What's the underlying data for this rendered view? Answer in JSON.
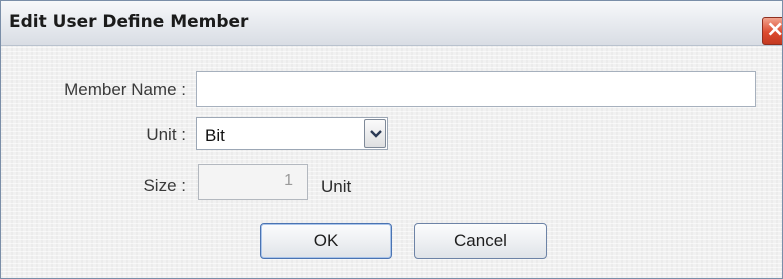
{
  "window": {
    "title": "Edit User Define Member",
    "close_symbol": "×"
  },
  "form": {
    "member_name_label": "Member Name :",
    "member_name_value": "",
    "unit_label": "Unit :",
    "unit_selected": "Bit",
    "size_label": "Size :",
    "size_value": "1",
    "size_unit": "Unit"
  },
  "buttons": {
    "ok_label": "OK",
    "cancel_label": "Cancel"
  },
  "colors": {
    "close_button": "#dc4b2f",
    "title_bar": "#e6e9ee",
    "dialog_background": "#f0f0f0"
  }
}
